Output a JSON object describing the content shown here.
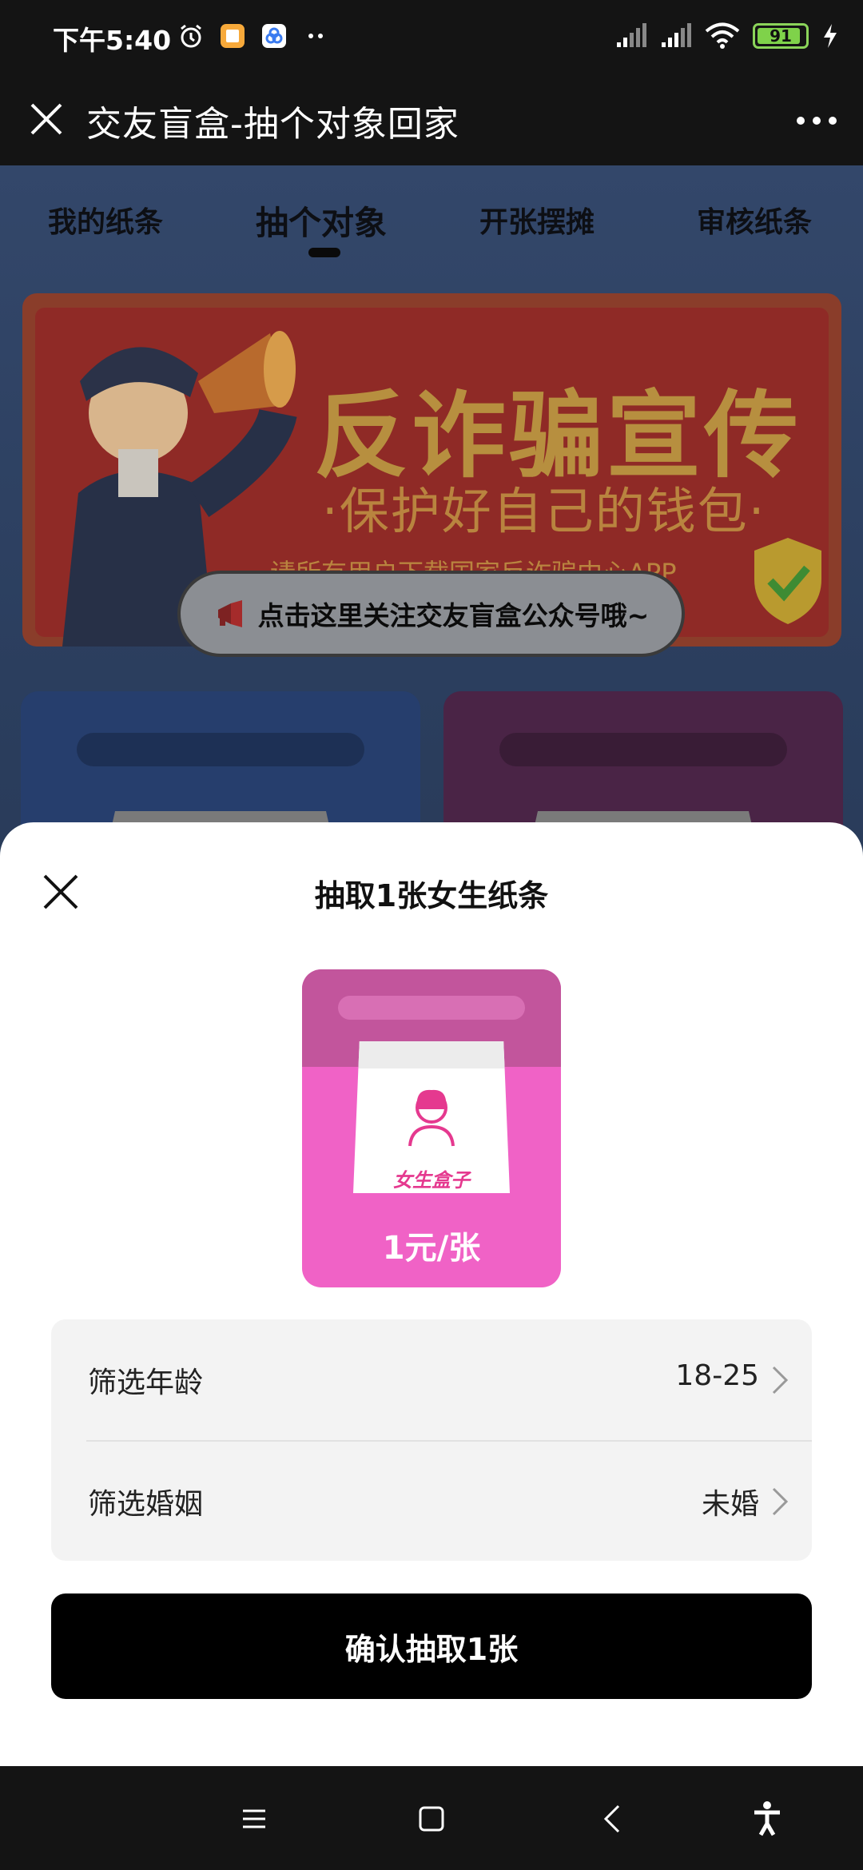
{
  "status_bar": {
    "time": "下午5:40",
    "battery": "91",
    "icons": [
      "alarm-icon",
      "notes-app-icon",
      "cloud-app-icon",
      "more-dots-icon",
      "signal-icon",
      "signal-icon",
      "wifi-icon",
      "battery-icon",
      "charging-icon"
    ]
  },
  "header": {
    "title": "交友盲盒-抽个对象回家",
    "close_icon": "close-icon",
    "more_icon": "more-dots-icon"
  },
  "tabs": [
    {
      "label": "我的纸条"
    },
    {
      "label": "抽个对象"
    },
    {
      "label": "开张摆摊"
    },
    {
      "label": "审核纸条"
    }
  ],
  "active_tab": "抽个对象",
  "banner": {
    "title": "反诈骗宣传",
    "subtitle": "·保护好自己的钱包·",
    "small_text": "请所有用户下载国家反诈骗中心APP",
    "follow_text": "点击这里关注交友盲盒公众号哦~"
  },
  "sheet": {
    "title": "抽取1张女生纸条",
    "box_label": "女生盒子",
    "price": "1元/张",
    "filters": [
      {
        "label": "筛选年龄",
        "value": "18-25"
      },
      {
        "label": "筛选婚姻",
        "value": "未婚"
      }
    ],
    "confirm_label": "确认抽取1张"
  },
  "colors": {
    "accent_pink": "#f062c6",
    "confirm_bg": "#000000",
    "battery_green": "#7fd24a"
  }
}
